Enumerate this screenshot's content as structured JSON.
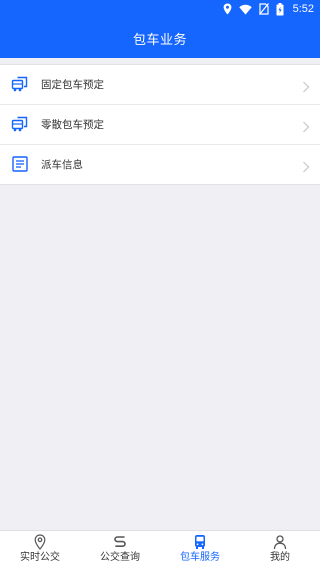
{
  "status_bar": {
    "time": "5:52",
    "icons": [
      "location-icon",
      "wifi-icon",
      "no-sim-icon",
      "battery-icon"
    ]
  },
  "header": {
    "title": "包车业务"
  },
  "menu": {
    "items": [
      {
        "label": "固定包车预定",
        "icon": "bus-icon"
      },
      {
        "label": "零散包车预定",
        "icon": "bus-icon"
      },
      {
        "label": "派车信息",
        "icon": "document-icon"
      }
    ]
  },
  "tab_bar": {
    "tabs": [
      {
        "label": "实时公交",
        "icon": "location-pin-icon",
        "active": false
      },
      {
        "label": "公交查询",
        "icon": "route-icon",
        "active": false
      },
      {
        "label": "包车服务",
        "icon": "bus-icon",
        "active": true
      },
      {
        "label": "我的",
        "icon": "user-icon",
        "active": false
      }
    ]
  },
  "colors": {
    "primary": "#1565ff",
    "background": "#efeff4",
    "text": "#333333",
    "chevron": "#c7c7cc"
  }
}
